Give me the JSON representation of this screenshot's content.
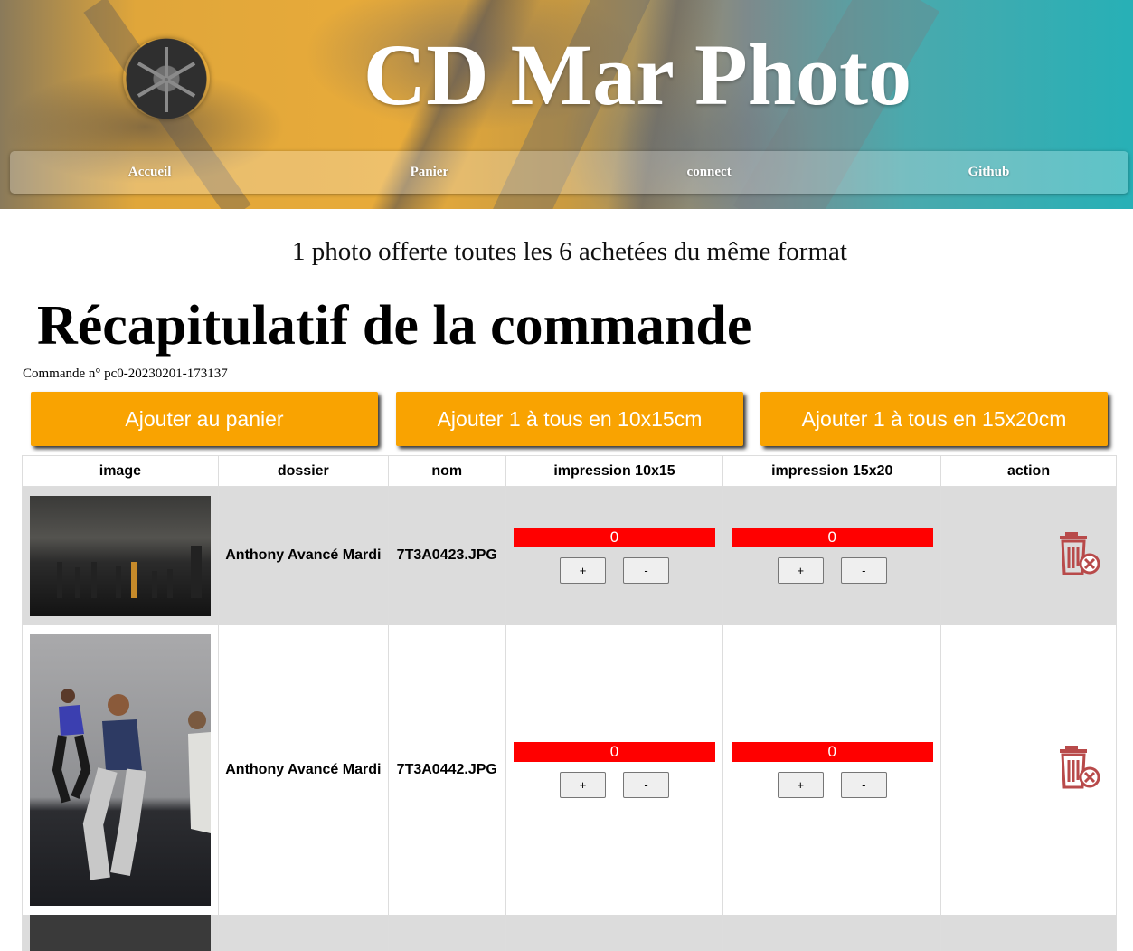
{
  "header": {
    "title": "CD Mar Photo",
    "nav": [
      "Accueil",
      "Panier",
      "connect",
      "Github"
    ]
  },
  "promo": "1 photo offerte toutes les 6 achetées du même format",
  "page_title": "Récapitulatif de la commande",
  "order_number": "Commande n° pc0-20230201-173137",
  "actions": {
    "add_to_cart": "Ajouter au panier",
    "add_all_10x15": "Ajouter 1 à tous en 10x15cm",
    "add_all_15x20": "Ajouter 1 à tous en 15x20cm"
  },
  "table": {
    "headers": [
      "image",
      "dossier",
      "nom",
      "impression 10x15",
      "impression 15x20",
      "action"
    ],
    "rows": [
      {
        "dossier": "Anthony Avancé Mardi",
        "nom": "7T3A0423.JPG",
        "qty_10x15": "0",
        "qty_15x20": "0",
        "plus": "+",
        "minus": "-"
      },
      {
        "dossier": "Anthony Avancé Mardi",
        "nom": "7T3A0442.JPG",
        "qty_10x15": "0",
        "qty_15x20": "0",
        "plus": "+",
        "minus": "-"
      }
    ]
  },
  "colors": {
    "accent": "#f9a301",
    "qty_bar": "#ff0000",
    "trash_icon": "#b84a4a",
    "row_grey": "#dcdcdc"
  }
}
